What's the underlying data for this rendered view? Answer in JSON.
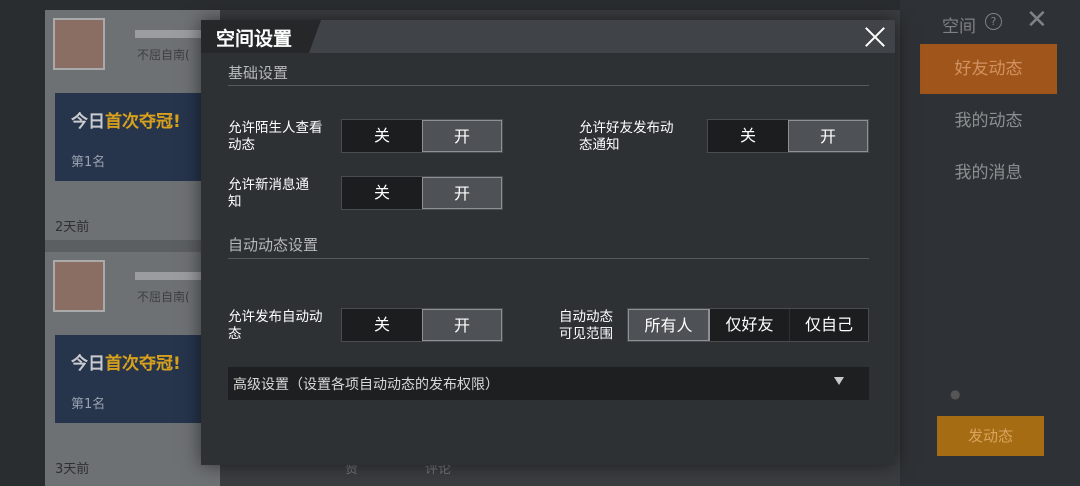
{
  "background": {
    "feed": [
      {
        "note": "不屈自南(",
        "banner_prefix": "今日",
        "banner_highlight": "首次夺冠!",
        "rank": "第1名",
        "time": "2天前"
      },
      {
        "note": "不屈自南(",
        "banner_prefix": "今日",
        "banner_highlight": "首次夺冠!",
        "rank": "第1名",
        "time": "3天前"
      }
    ],
    "bottom_actions": [
      "赞",
      "评论"
    ],
    "right_panel": {
      "title": "空间",
      "help": "?",
      "close": "✕",
      "tabs": [
        {
          "label": "好友动态",
          "active": true
        },
        {
          "label": "我的动态",
          "active": false
        },
        {
          "label": "我的消息",
          "active": false
        }
      ],
      "toggle_text": "●",
      "post_button": "发动态"
    }
  },
  "modal": {
    "title": "空间设置",
    "sections": {
      "basic": {
        "title": "基础设置",
        "settings": [
          {
            "label": "允许陌生人查看动态",
            "options": [
              "关",
              "开"
            ],
            "selected": "开"
          },
          {
            "label": "允许好友发布动态通知",
            "options": [
              "关",
              "开"
            ],
            "selected": "开"
          },
          {
            "label": "允许新消息通知",
            "options": [
              "关",
              "开"
            ],
            "selected": "开"
          }
        ]
      },
      "auto": {
        "title": "自动动态设置",
        "settings": [
          {
            "label": "允许发布自动动态",
            "options": [
              "关",
              "开"
            ],
            "selected": "开"
          },
          {
            "label": "自动动态可见范围",
            "options": [
              "所有人",
              "仅好友",
              "仅自己"
            ],
            "selected": "所有人"
          }
        ]
      }
    },
    "advanced": {
      "label": "高级设置（设置各项自动动态的发布权限）"
    }
  },
  "colors": {
    "accent_orange": "#a0551b",
    "selected_option_bg": "#4e5256",
    "unselected_option_bg": "#1c1d1f"
  }
}
